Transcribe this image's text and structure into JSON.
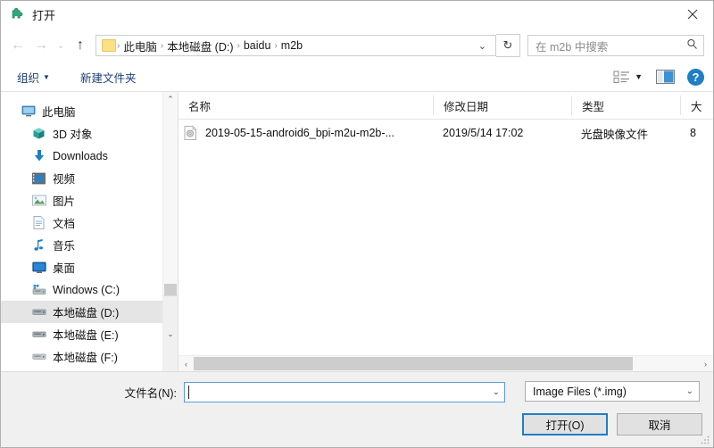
{
  "window": {
    "title": "打开",
    "title_icon": "puzzle-piece-icon",
    "close_label": "✕"
  },
  "navigation": {
    "back_icon": "←",
    "forward_icon": "→",
    "recent_icon": "⌄",
    "up_icon": "↑",
    "refresh_icon": "↻",
    "dropdown_icon": "⌄",
    "breadcrumbs": [
      "此电脑",
      "本地磁盘 (D:)",
      "baidu",
      "m2b"
    ],
    "separator": "›"
  },
  "search": {
    "placeholder": "在 m2b 中搜索",
    "icon": "search-icon"
  },
  "toolbar": {
    "organize_label": "组织",
    "organize_caret": "▼",
    "new_folder_label": "新建文件夹",
    "view_caret": "▼",
    "help_label": "?"
  },
  "sidebar": {
    "items": [
      {
        "label": "此电脑",
        "icon": "monitor-icon",
        "level": 1,
        "selected": false
      },
      {
        "label": "3D 对象",
        "icon": "cube-icon",
        "level": 2,
        "selected": false
      },
      {
        "label": "Downloads",
        "icon": "download-icon",
        "level": 2,
        "selected": false
      },
      {
        "label": "视频",
        "icon": "video-icon",
        "level": 2,
        "selected": false
      },
      {
        "label": "图片",
        "icon": "picture-icon",
        "level": 2,
        "selected": false
      },
      {
        "label": "文档",
        "icon": "document-icon",
        "level": 2,
        "selected": false
      },
      {
        "label": "音乐",
        "icon": "music-note-icon",
        "level": 2,
        "selected": false
      },
      {
        "label": "桌面",
        "icon": "desktop-icon",
        "level": 2,
        "selected": false
      },
      {
        "label": "Windows (C:)",
        "icon": "system-drive-icon",
        "level": 2,
        "selected": false
      },
      {
        "label": "本地磁盘 (D:)",
        "icon": "drive-icon",
        "level": 2,
        "selected": true
      },
      {
        "label": "本地磁盘 (E:)",
        "icon": "drive-icon",
        "level": 2,
        "selected": false
      },
      {
        "label": "本地磁盘 (F:)",
        "icon": "drive-icon",
        "level": 2,
        "selected": false
      }
    ]
  },
  "filelist": {
    "columns": [
      {
        "label": "名称",
        "sorted": "asc"
      },
      {
        "label": "修改日期",
        "sorted": ""
      },
      {
        "label": "类型",
        "sorted": ""
      },
      {
        "label": "大",
        "sorted": ""
      }
    ],
    "sort_caret": "⌃",
    "rows": [
      {
        "name": "2019-05-15-android6_bpi-m2u-m2b-...",
        "date": "2019/5/14 17:02",
        "type": "光盘映像文件",
        "size": "8",
        "icon": "disc-image-file-icon"
      }
    ]
  },
  "scrollbars": {
    "up_arrow": "⌃",
    "down_arrow": "⌄",
    "left_arrow": "‹",
    "right_arrow": "›"
  },
  "bottom": {
    "filename_label": "文件名(N):",
    "filename_value": "",
    "filename_chevron": "⌄",
    "filter_value": "Image Files (*.img)",
    "filter_chevron": "⌄",
    "open_button": "打开(O)",
    "cancel_button": "取消"
  }
}
